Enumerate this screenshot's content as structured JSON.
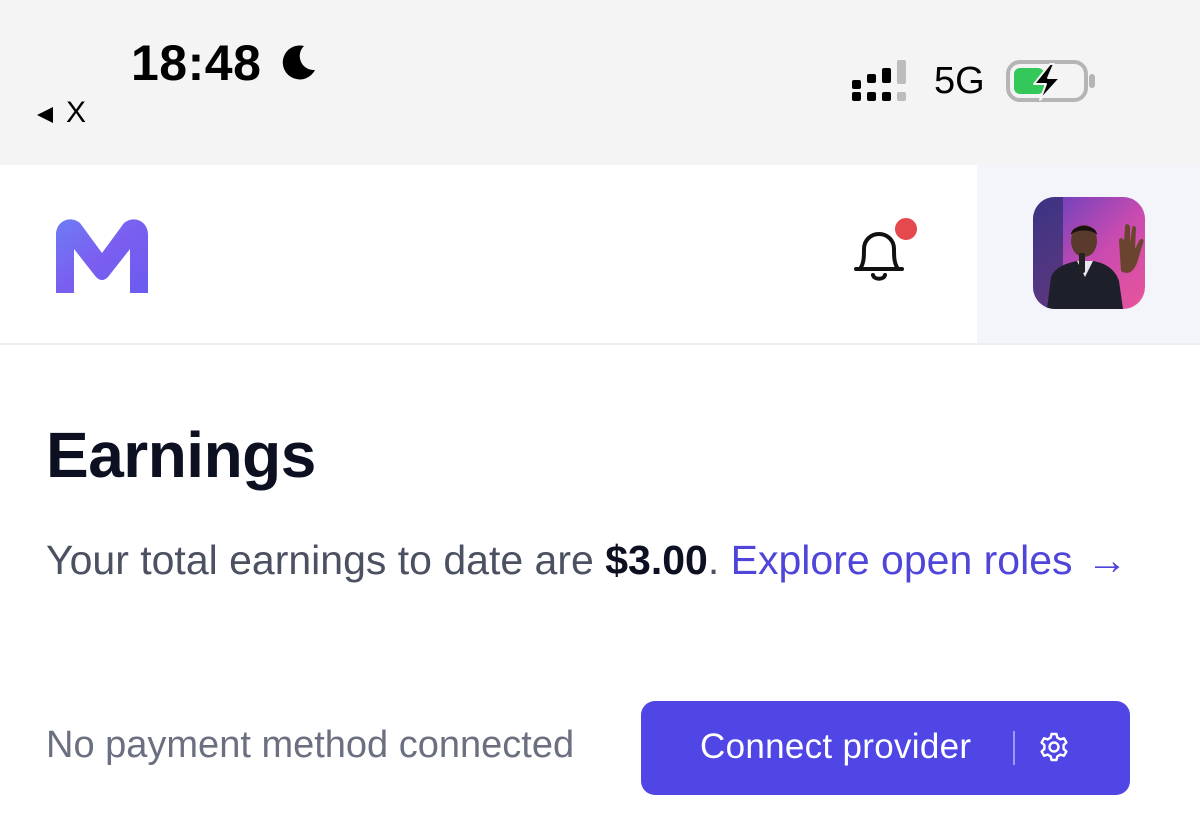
{
  "status_bar": {
    "time": "18:48",
    "back_label": "X",
    "network": "5G",
    "icons": [
      "moon-icon",
      "back-arrow-icon",
      "signal-icon",
      "battery-charging-icon"
    ]
  },
  "header": {
    "logo": "m-logo-icon",
    "notification_icon": "bell-icon",
    "has_notification": true,
    "avatar": "user-avatar"
  },
  "main": {
    "title": "Earnings",
    "earnings_prefix": "Your total earnings to date are ",
    "earnings_amount": "$3.00",
    "earnings_suffix": ".",
    "explore_link": "Explore open roles",
    "explore_arrow": "→",
    "payment_status": "No payment method connected",
    "connect_button": "Connect provider",
    "settings_icon": "gear-icon"
  },
  "colors": {
    "accent": "#4f46e5",
    "link": "#4f46d9",
    "notification": "#e5484d",
    "battery": "#34c759"
  }
}
